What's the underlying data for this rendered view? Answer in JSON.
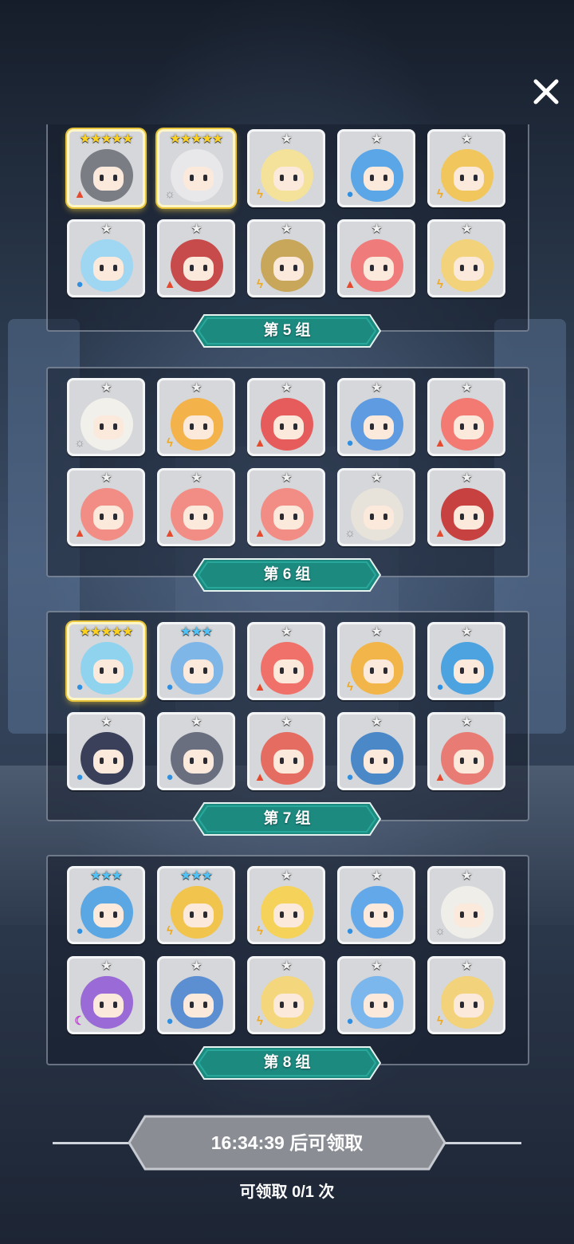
{
  "close_icon": "close-icon",
  "groups": [
    {
      "label": "第 5 组",
      "cards": [
        {
          "stars": "★★★★★",
          "star_color": "gold",
          "element": "fire",
          "color": "#7a7d84",
          "highlight": true
        },
        {
          "stars": "★★★★★",
          "star_color": "gold",
          "element": "light",
          "color": "#e8e8ea",
          "highlight": true
        },
        {
          "stars": "★",
          "star_color": "silver",
          "element": "thunder",
          "color": "#f4e29a",
          "highlight": false
        },
        {
          "stars": "★",
          "star_color": "silver",
          "element": "water",
          "color": "#5aa6e6",
          "highlight": false
        },
        {
          "stars": "★",
          "star_color": "silver",
          "element": "thunder",
          "color": "#f1c65c",
          "highlight": false
        },
        {
          "stars": "★",
          "star_color": "silver",
          "element": "water",
          "color": "#9fd6f2",
          "highlight": false
        },
        {
          "stars": "★",
          "star_color": "silver",
          "element": "fire",
          "color": "#c84b4b",
          "highlight": false
        },
        {
          "stars": "★",
          "star_color": "silver",
          "element": "thunder",
          "color": "#c8a65a",
          "highlight": false
        },
        {
          "stars": "★",
          "star_color": "silver",
          "element": "fire",
          "color": "#ef7b7b",
          "highlight": false
        },
        {
          "stars": "★",
          "star_color": "silver",
          "element": "thunder",
          "color": "#f2d27a",
          "highlight": false
        }
      ]
    },
    {
      "label": "第 6 组",
      "cards": [
        {
          "stars": "★",
          "star_color": "silver",
          "element": "light",
          "color": "#f2f0ea",
          "highlight": false
        },
        {
          "stars": "★",
          "star_color": "silver",
          "element": "thunder",
          "color": "#f4b24a",
          "highlight": false
        },
        {
          "stars": "★",
          "star_color": "silver",
          "element": "fire",
          "color": "#e65b5b",
          "highlight": false
        },
        {
          "stars": "★",
          "star_color": "silver",
          "element": "water",
          "color": "#5f9be0",
          "highlight": false
        },
        {
          "stars": "★",
          "star_color": "silver",
          "element": "fire",
          "color": "#f27a72",
          "highlight": false
        },
        {
          "stars": "★",
          "star_color": "silver",
          "element": "fire",
          "color": "#f28d86",
          "highlight": false
        },
        {
          "stars": "★",
          "star_color": "silver",
          "element": "fire",
          "color": "#f28d86",
          "highlight": false
        },
        {
          "stars": "★",
          "star_color": "silver",
          "element": "fire",
          "color": "#f28d86",
          "highlight": false
        },
        {
          "stars": "★",
          "star_color": "silver",
          "element": "light",
          "color": "#e7e3da",
          "highlight": false
        },
        {
          "stars": "★",
          "star_color": "silver",
          "element": "fire",
          "color": "#c84141",
          "highlight": false
        }
      ]
    },
    {
      "label": "第 7 组",
      "cards": [
        {
          "stars": "★★★★★",
          "star_color": "gold",
          "element": "water",
          "color": "#8fd3ef",
          "highlight": true
        },
        {
          "stars": "★★★",
          "star_color": "blue",
          "element": "water",
          "color": "#7fb6e8",
          "highlight": false
        },
        {
          "stars": "★",
          "star_color": "silver",
          "element": "fire",
          "color": "#f0716a",
          "highlight": false
        },
        {
          "stars": "★",
          "star_color": "silver",
          "element": "thunder",
          "color": "#f1b54a",
          "highlight": false
        },
        {
          "stars": "★",
          "star_color": "silver",
          "element": "water",
          "color": "#4da3e0",
          "highlight": false
        },
        {
          "stars": "★",
          "star_color": "silver",
          "element": "water",
          "color": "#3a3f5a",
          "highlight": false
        },
        {
          "stars": "★",
          "star_color": "silver",
          "element": "water",
          "color": "#6a6f80",
          "highlight": false
        },
        {
          "stars": "★",
          "star_color": "silver",
          "element": "fire",
          "color": "#e46c60",
          "highlight": false
        },
        {
          "stars": "★",
          "star_color": "silver",
          "element": "water",
          "color": "#4a88c8",
          "highlight": false
        },
        {
          "stars": "★",
          "star_color": "silver",
          "element": "fire",
          "color": "#e87c74",
          "highlight": false
        }
      ]
    },
    {
      "label": "第 8 组",
      "cards": [
        {
          "stars": "★★★",
          "star_color": "blue",
          "element": "water",
          "color": "#5ba7e4",
          "highlight": false
        },
        {
          "stars": "★★★",
          "star_color": "blue",
          "element": "thunder",
          "color": "#f1c44e",
          "highlight": false
        },
        {
          "stars": "★",
          "star_color": "silver",
          "element": "thunder",
          "color": "#f5d35a",
          "highlight": false
        },
        {
          "stars": "★",
          "star_color": "silver",
          "element": "water",
          "color": "#63a9ea",
          "highlight": false
        },
        {
          "stars": "★",
          "star_color": "silver",
          "element": "light",
          "color": "#efeee9",
          "highlight": false
        },
        {
          "stars": "★",
          "star_color": "silver",
          "element": "dark",
          "color": "#9a6ad6",
          "highlight": false
        },
        {
          "stars": "★",
          "star_color": "silver",
          "element": "water",
          "color": "#5c8fd2",
          "highlight": false
        },
        {
          "stars": "★",
          "star_color": "silver",
          "element": "thunder",
          "color": "#f4d77c",
          "highlight": false
        },
        {
          "stars": "★",
          "star_color": "silver",
          "element": "water",
          "color": "#7bb6ec",
          "highlight": false
        },
        {
          "stars": "★",
          "star_color": "silver",
          "element": "thunder",
          "color": "#f2d27a",
          "highlight": false
        }
      ]
    }
  ],
  "element_icons": {
    "fire": "fire-icon",
    "water": "water-drop-icon",
    "thunder": "thunder-icon",
    "light": "sun-icon",
    "dark": "moon-icon"
  },
  "claim_button": {
    "label": "16:34:39 后可领取"
  },
  "claim_count": "可领取 0/1 次",
  "colors": {
    "banner": "#1d8a80",
    "banner_light": "#28a89b",
    "claim": "#8c9096"
  }
}
